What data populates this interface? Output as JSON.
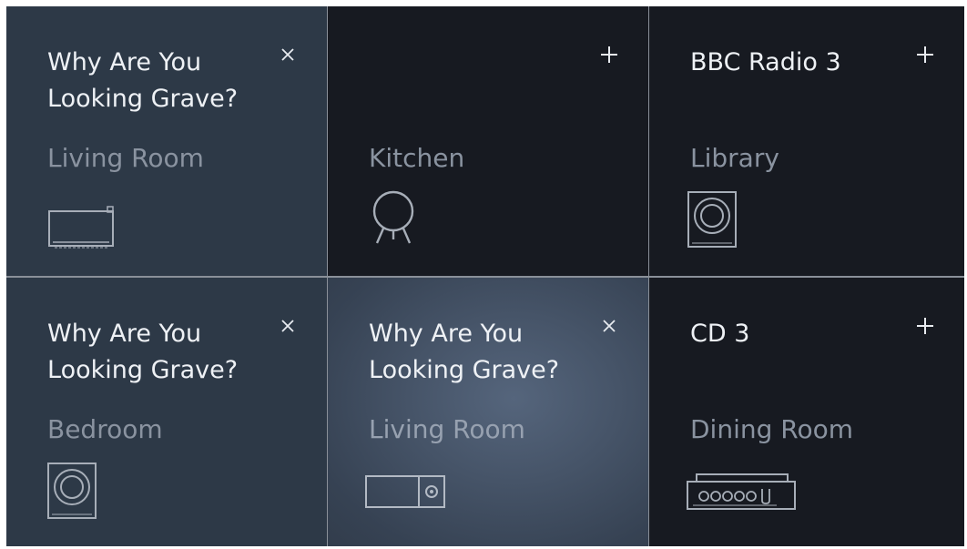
{
  "tiles": [
    {
      "title": "Why Are You Looking Grave?",
      "room": "Living Room",
      "action_icon": "close-icon",
      "device_icon": "tv-soundbar-icon",
      "state": "linked"
    },
    {
      "title": "",
      "room": "Kitchen",
      "action_icon": "plus-icon",
      "device_icon": "tripod-speaker-icon",
      "state": "idle"
    },
    {
      "title": "BBC Radio 3",
      "room": "Library",
      "action_icon": "plus-icon",
      "device_icon": "subwoofer-speaker-icon",
      "state": "idle"
    },
    {
      "title": "Why Are You Looking Grave?",
      "room": "Bedroom",
      "action_icon": "close-icon",
      "device_icon": "subwoofer-speaker-icon",
      "state": "linked"
    },
    {
      "title": "Why Are You Looking Grave?",
      "room": "Living Room",
      "action_icon": "close-icon",
      "device_icon": "portable-speaker-icon",
      "state": "active"
    },
    {
      "title": "CD 3",
      "room": "Dining Room",
      "action_icon": "plus-icon",
      "device_icon": "cd-player-icon",
      "state": "idle"
    }
  ],
  "colors": {
    "tile_linked": "#2d3947",
    "tile_idle": "#171a21",
    "tile_active": "#4a586d",
    "title_text": "#eef1f5",
    "room_text": "#8a93a0"
  }
}
